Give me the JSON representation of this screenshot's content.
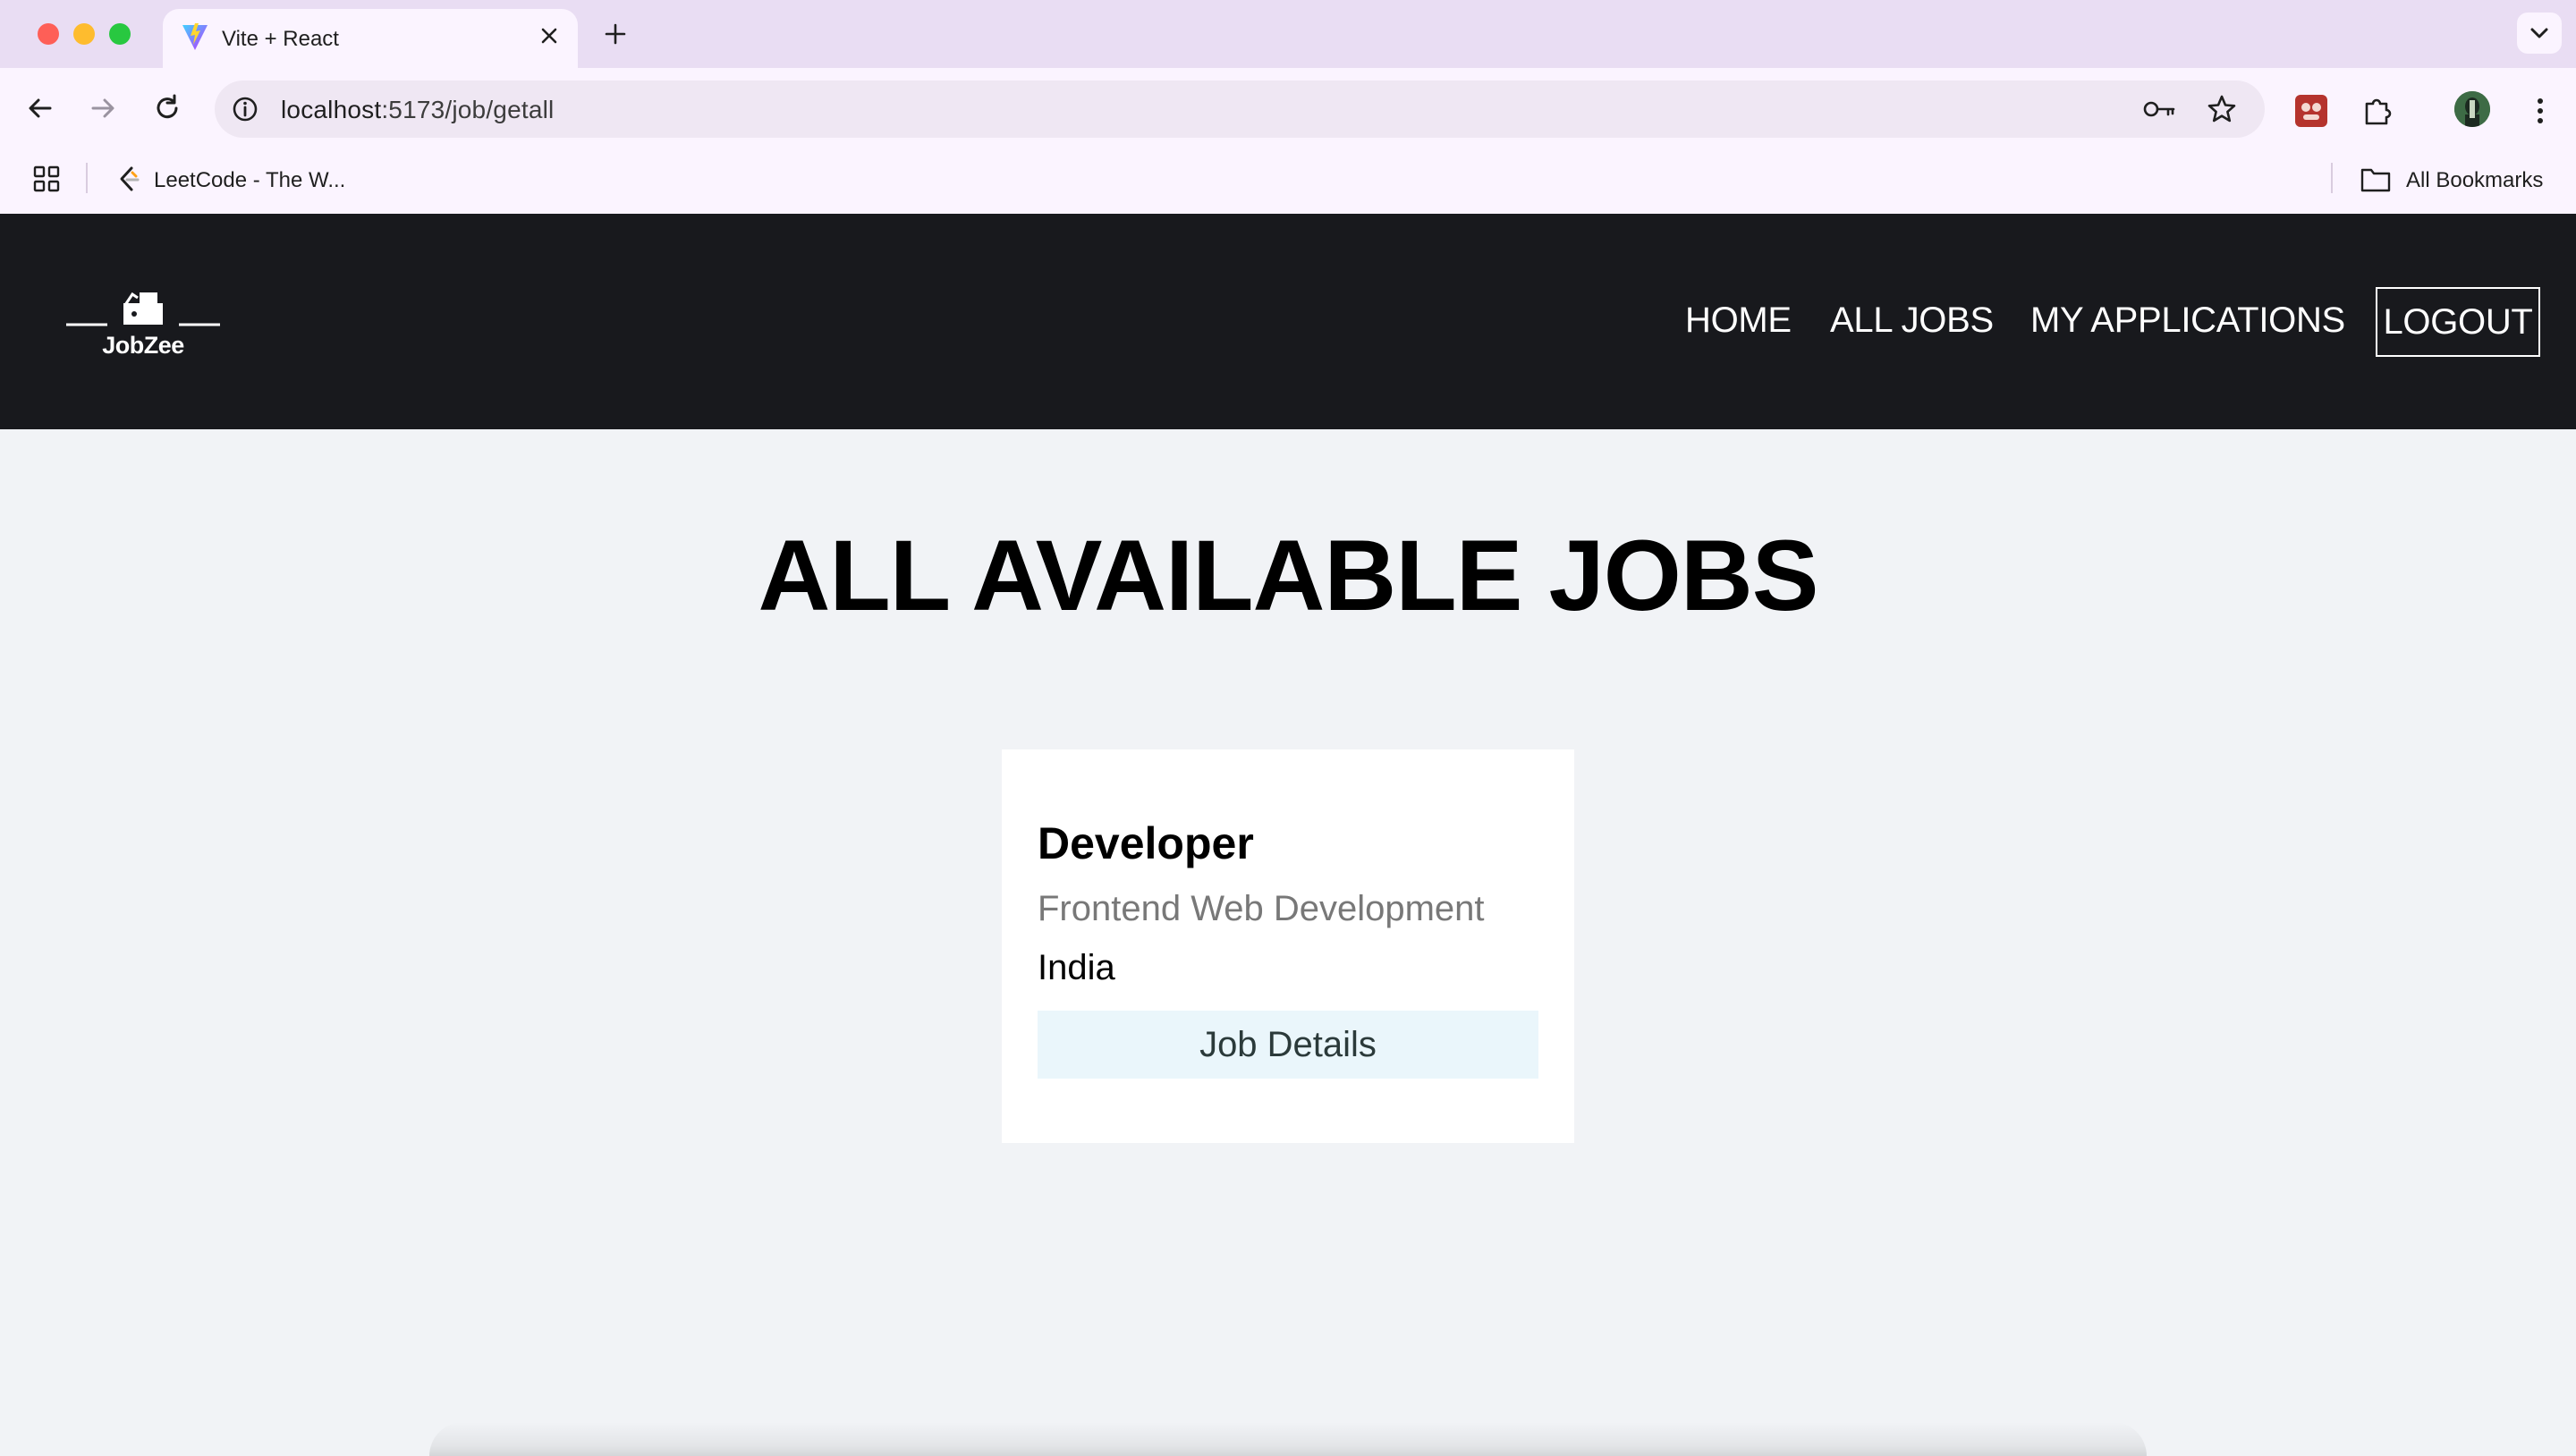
{
  "browser": {
    "tab_title": "Vite + React",
    "url_host": "localhost",
    "url_rest": ":5173/job/getall",
    "bookmarks": [
      {
        "label": "LeetCode - The W..."
      }
    ],
    "all_bookmarks_label": "All Bookmarks"
  },
  "site": {
    "logo_text": "JobZee",
    "nav": {
      "home": "HOME",
      "all_jobs": "ALL JOBS",
      "my_applications": "MY APPLICATIONS",
      "logout": "LOGOUT"
    }
  },
  "main": {
    "heading": "ALL AVAILABLE JOBS",
    "jobs": [
      {
        "title": "Developer",
        "category": "Frontend Web Development",
        "country": "India",
        "button_label": "Job Details"
      }
    ]
  }
}
